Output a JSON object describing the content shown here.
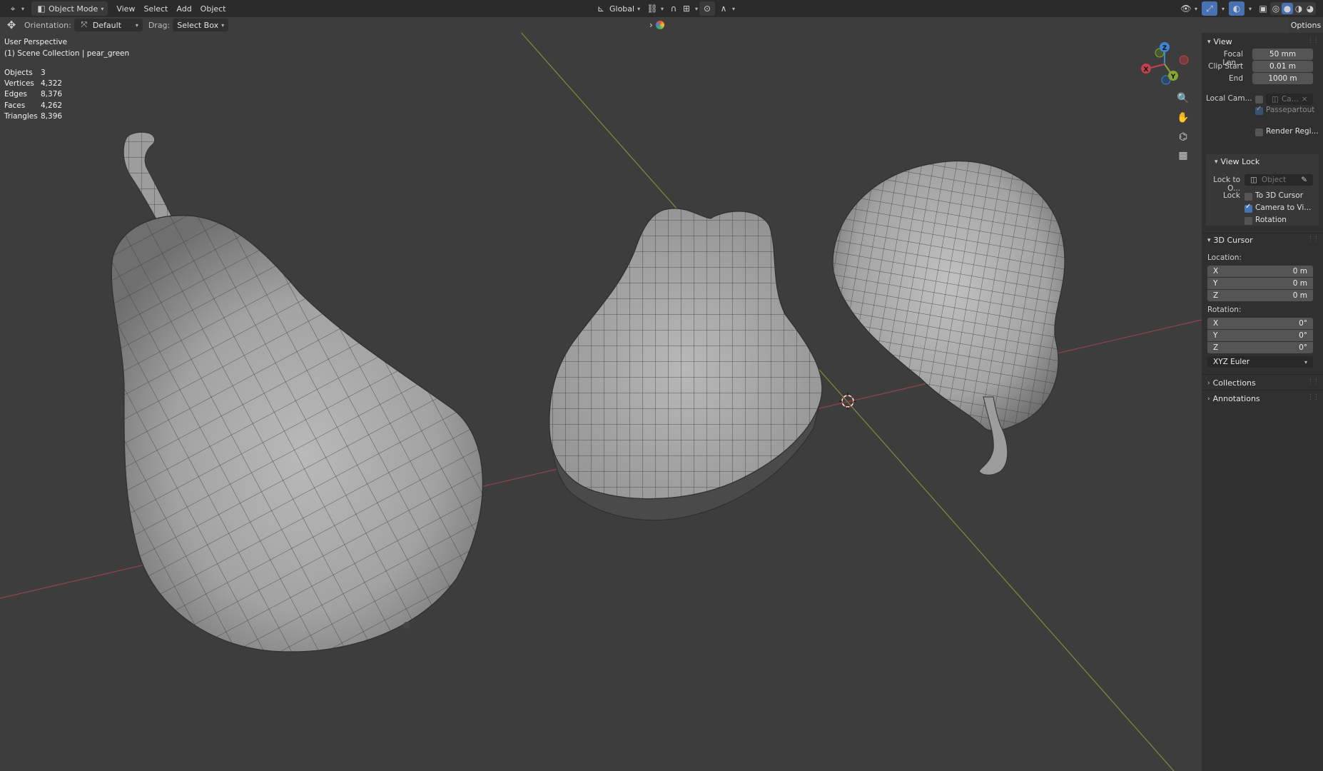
{
  "header": {
    "editor_icon": "viewport-editor-icon",
    "mode": "Object Mode",
    "menus": [
      "View",
      "Select",
      "Add",
      "Object"
    ],
    "transform_orientation": "Global"
  },
  "toolbar": {
    "orientation_label": "Orientation:",
    "orientation_value": "Default",
    "drag_label": "Drag:",
    "drag_value": "Select Box"
  },
  "overlay": {
    "view_name": "User Perspective",
    "collection": "(1) Scene Collection | pear_green",
    "stats": [
      {
        "key": "Objects",
        "value": "3"
      },
      {
        "key": "Vertices",
        "value": "4,322"
      },
      {
        "key": "Edges",
        "value": "8,376"
      },
      {
        "key": "Faces",
        "value": "4,262"
      },
      {
        "key": "Triangles",
        "value": "8,396"
      }
    ]
  },
  "sidebar": {
    "tab_label": "Options",
    "view_panel": {
      "title": "View",
      "focal_label": "Focal Len...",
      "focal_value": "50 mm",
      "clip_start_label": "Clip Start",
      "clip_start_value": "0.01 m",
      "end_label": "End",
      "end_value": "1000 m",
      "local_camera_label": "Local Cam...",
      "local_camera_value": "Ca...",
      "passepartout_label": "Passepartout",
      "render_region_label": "Render Regi..."
    },
    "view_lock": {
      "title": "View Lock",
      "lock_to_label": "Lock to O...",
      "lock_to_placeholder": "Object",
      "lock_label": "Lock",
      "to_cursor_label": "To 3D Cursor",
      "camera_to_view_label": "Camera to Vi...",
      "rotation_label": "Rotation"
    },
    "cursor_panel": {
      "title": "3D Cursor",
      "location_label": "Location:",
      "location": [
        {
          "axis": "X",
          "value": "0 m"
        },
        {
          "axis": "Y",
          "value": "0 m"
        },
        {
          "axis": "Z",
          "value": "0 m"
        }
      ],
      "rotation_label": "Rotation:",
      "rotation": [
        {
          "axis": "X",
          "value": "0°"
        },
        {
          "axis": "Y",
          "value": "0°"
        },
        {
          "axis": "Z",
          "value": "0°"
        }
      ],
      "rotation_mode": "XYZ Euler"
    },
    "collections_title": "Collections",
    "annotations_title": "Annotations"
  },
  "gizmo": {
    "x": "X",
    "y": "Y",
    "z": "Z"
  },
  "colors": {
    "x_axis": "#c0414f",
    "y_axis": "#86a832",
    "z_axis": "#3d85d6",
    "accent": "#4772b3"
  }
}
